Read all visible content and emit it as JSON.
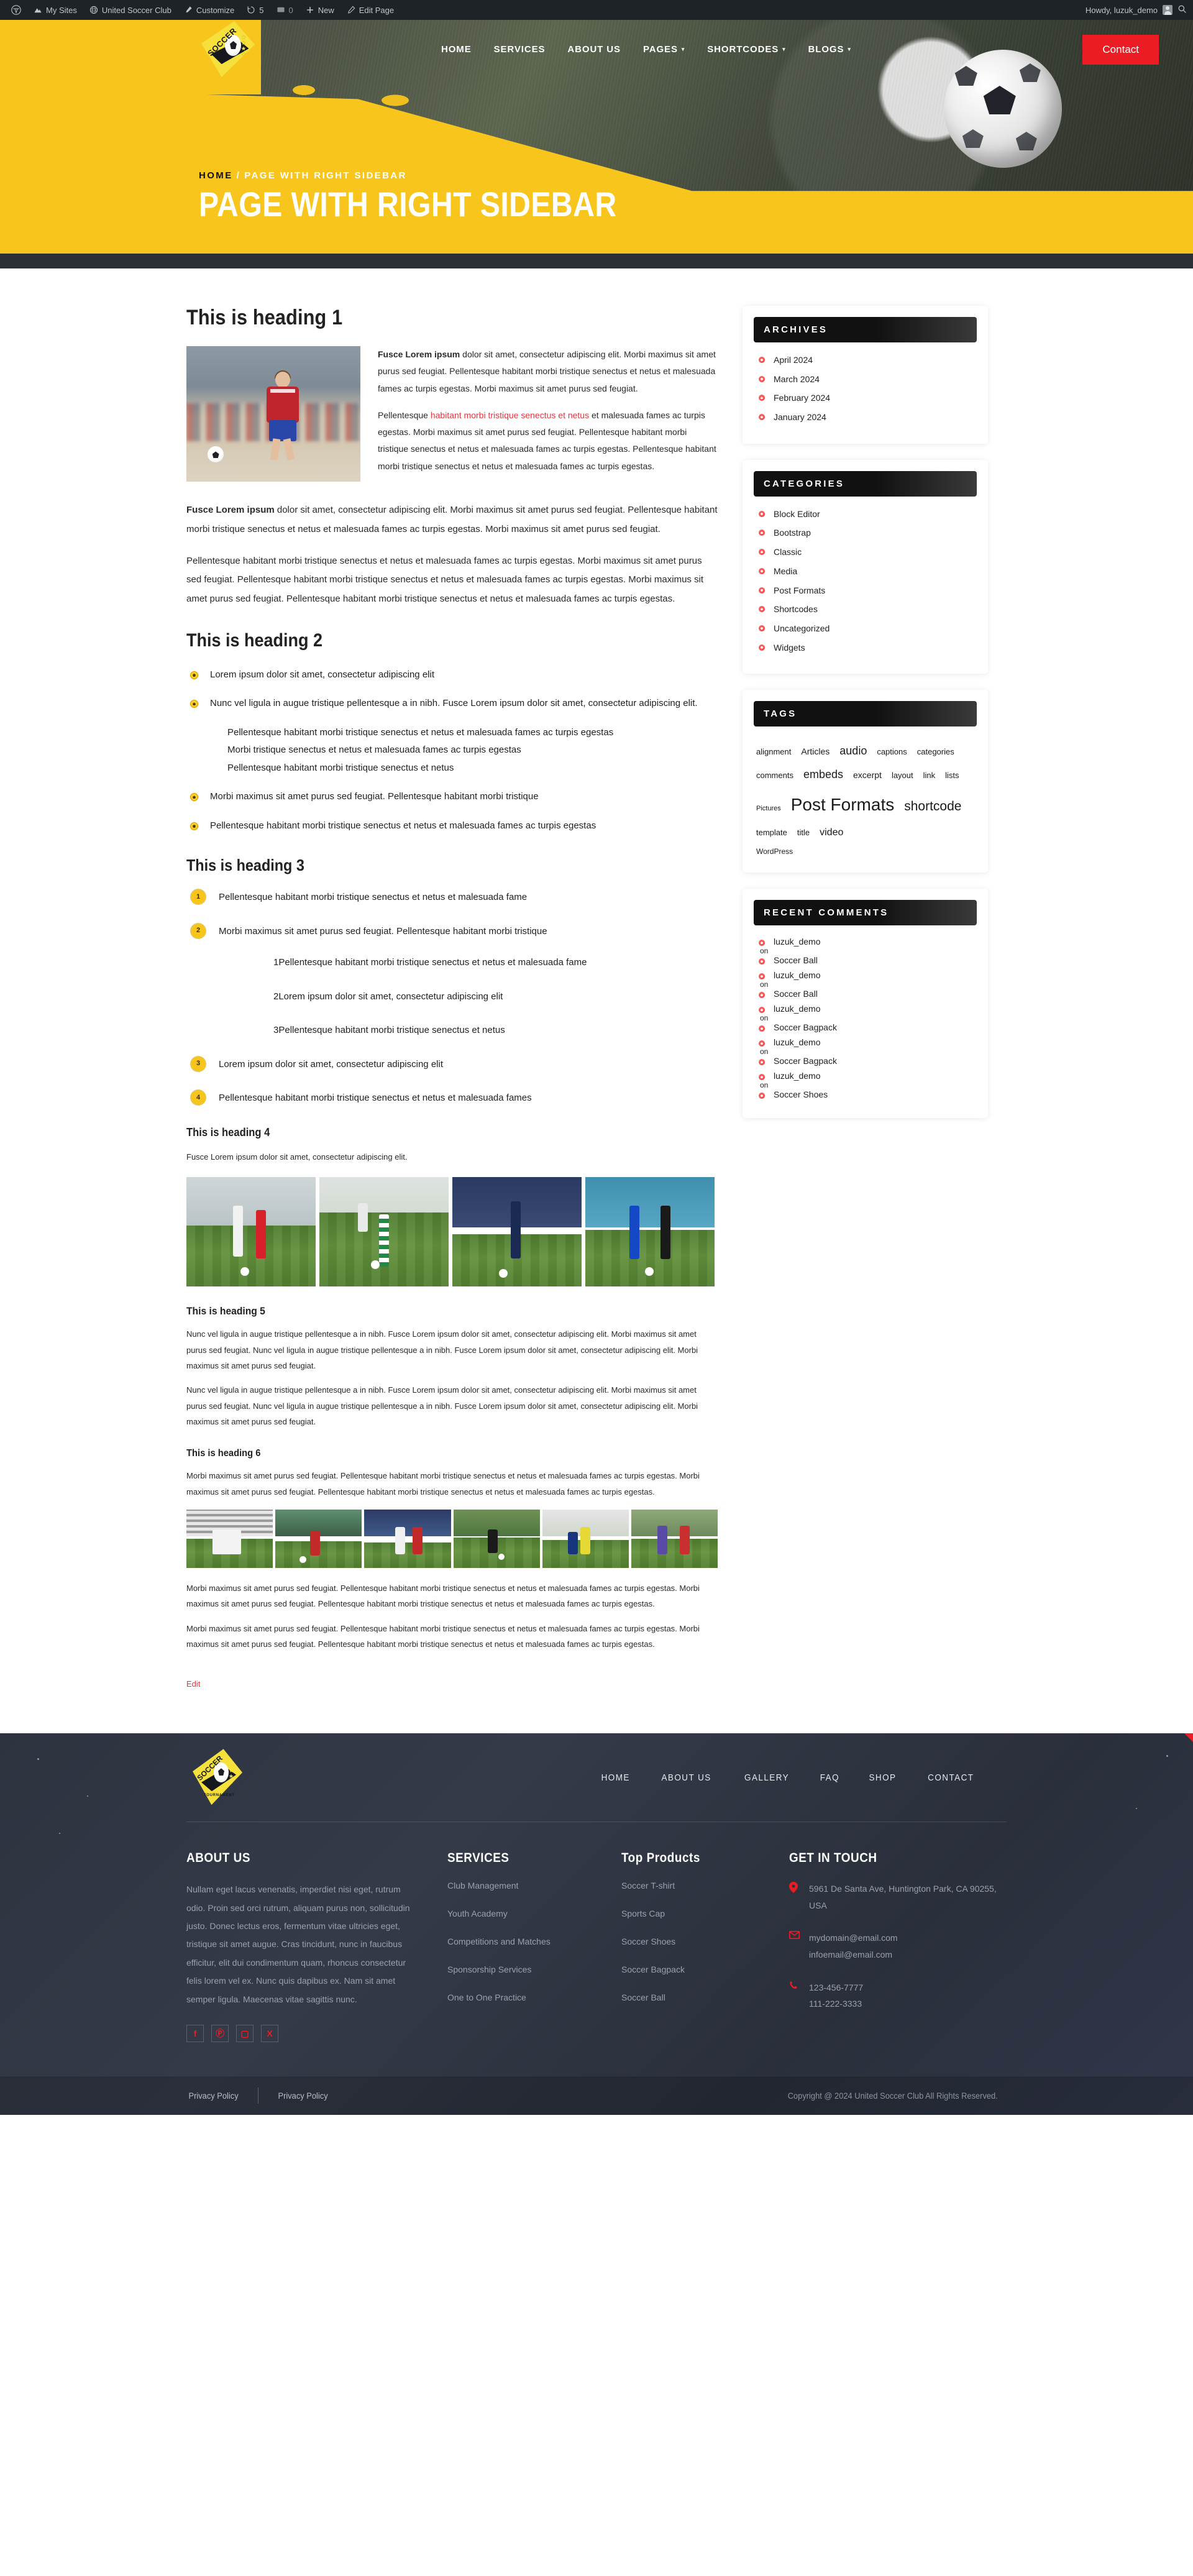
{
  "adminbar": {
    "items": [
      {
        "icon": "wordpress-icon",
        "label": ""
      },
      {
        "icon": "my-sites-icon",
        "label": "My Sites"
      },
      {
        "icon": "site-icon",
        "label": "United Soccer Club"
      },
      {
        "icon": "customize-icon",
        "label": "Customize"
      },
      {
        "icon": "updates-icon",
        "label": "5"
      },
      {
        "icon": "comments-icon",
        "label": "0"
      },
      {
        "icon": "new-icon",
        "label": "New"
      },
      {
        "icon": "edit-icon",
        "label": "Edit Page"
      }
    ],
    "howdy": "Howdy, luzuk_demo",
    "search_icon": "search-icon"
  },
  "header": {
    "logo_text": "SOCCER",
    "nav": [
      {
        "label": "HOME",
        "has_caret": false
      },
      {
        "label": "SERVICES",
        "has_caret": false
      },
      {
        "label": "ABOUT US",
        "has_caret": false
      },
      {
        "label": "PAGES",
        "has_caret": true
      },
      {
        "label": "SHORTCODES",
        "has_caret": true
      },
      {
        "label": "BLOGS",
        "has_caret": true
      }
    ],
    "contact_button": "Contact",
    "breadcrumb_home": "HOME",
    "breadcrumb_sep": "/",
    "breadcrumb_current": "PAGE WITH RIGHT SIDEBAR",
    "page_title": "PAGE WITH RIGHT SIDEBAR"
  },
  "colors": {
    "accent_yellow": "#f7c51b",
    "accent_red": "#ec1c24",
    "link_red": "#e8333a",
    "dark": "#2b2f36",
    "footer_bg": "#2e3340"
  },
  "content": {
    "h1": "This is heading 1",
    "intro_p1_bold": "Fusce Lorem ipsum",
    "intro_p1_rest": " dolor sit amet, consectetur adipiscing elit. Morbi maximus sit amet purus sed feugiat. Pellentesque habitant morbi tristique senectus et netus et malesuada fames ac turpis egestas. Morbi maximus sit amet purus sed feugiat.",
    "intro_p2_a": "Pellentesque ",
    "intro_p2_link": "habitant morbi tristique senectus et netus",
    "intro_p2_b": " et malesuada fames ac turpis egestas. Morbi maximus sit amet purus sed feugiat. Pellentesque habitant morbi tristique senectus et netus et malesuada fames ac turpis egestas. Pellentesque habitant morbi tristique senectus et netus et malesuada fames ac turpis egestas.",
    "p_after_bold": "Fusce Lorem ipsum",
    "p_after_rest": " dolor sit amet, consectetur adipiscing elit. Morbi maximus sit amet purus sed feugiat. Pellentesque habitant morbi tristique senectus et netus et malesuada fames ac turpis egestas. Morbi maximus sit amet purus sed feugiat.",
    "p_long": "Pellentesque habitant morbi tristique senectus et netus et malesuada fames ac turpis egestas. Morbi maximus sit amet purus sed feugiat. Pellentesque habitant morbi tristique senectus et netus et malesuada fames ac turpis egestas. Morbi maximus sit amet purus sed feugiat. Pellentesque habitant morbi tristique senectus et netus et malesuada fames ac turpis egestas.",
    "h2": "This is heading 2",
    "ul_items": [
      "Lorem ipsum dolor sit amet, consectetur adipiscing elit",
      "Nunc vel ligula in augue tristique pellentesque a in nibh. Fusce Lorem ipsum dolor sit amet, consectetur adipiscing elit."
    ],
    "ul_sub_items": [
      "Pellentesque habitant morbi tristique senectus et netus et malesuada fames ac turpis egestas",
      "Morbi tristique senectus et netus et malesuada fames ac turpis egestas",
      "Pellentesque habitant morbi tristique senectus et netus"
    ],
    "ul_items_after": [
      "Morbi maximus sit amet purus sed feugiat. Pellentesque habitant morbi tristique",
      "Pellentesque habitant morbi tristique senectus et netus et malesuada fames ac turpis egestas"
    ],
    "h3": "This is heading 3",
    "ol_items": [
      "Pellentesque habitant morbi tristique senectus et netus et malesuada fame",
      "Morbi maximus sit amet purus sed feugiat. Pellentesque habitant morbi tristique"
    ],
    "ol_sub_items": [
      "Pellentesque habitant morbi tristique senectus et netus et malesuada fame",
      "Lorem ipsum dolor sit amet, consectetur adipiscing elit",
      "Pellentesque habitant morbi tristique senectus et netus"
    ],
    "ol_items_after": [
      "Lorem ipsum dolor sit amet, consectetur adipiscing elit",
      "Pellentesque habitant morbi tristique senectus et netus et malesuada fames"
    ],
    "h4": "This is heading 4",
    "h4_p": "Fusce Lorem ipsum dolor sit amet, consectetur adipiscing elit.",
    "h5": "This is heading 5",
    "h5_p1": "Nunc vel ligula in augue tristique pellentesque a in nibh. Fusce Lorem ipsum dolor sit amet, consectetur adipiscing elit. Morbi maximus sit amet purus sed feugiat. Nunc vel ligula in augue tristique pellentesque a in nibh. Fusce Lorem ipsum dolor sit amet, consectetur adipiscing elit. Morbi maximus sit amet purus sed feugiat.",
    "h5_p2": "Nunc vel ligula in augue tristique pellentesque a in nibh. Fusce Lorem ipsum dolor sit amet, consectetur adipiscing elit. Morbi maximus sit amet purus sed feugiat. Nunc vel ligula in augue tristique pellentesque a in nibh. Fusce Lorem ipsum dolor sit amet, consectetur adipiscing elit. Morbi maximus sit amet purus sed feugiat.",
    "h6": "This is heading 6",
    "h6_p": "Morbi maximus sit amet purus sed feugiat. Pellentesque habitant morbi tristique senectus et netus et malesuada fames ac turpis egestas. Morbi maximus sit amet purus sed feugiat. Pellentesque habitant morbi tristique senectus et netus et malesuada fames ac turpis egestas.",
    "h6_p2": "Morbi maximus sit amet purus sed feugiat. Pellentesque habitant morbi tristique senectus et netus et malesuada fames ac turpis egestas. Morbi maximus sit amet purus sed feugiat. Pellentesque habitant morbi tristique senectus et netus et malesuada fames ac turpis egestas.",
    "h6_p3": "Morbi maximus sit amet purus sed feugiat. Pellentesque habitant morbi tristique senectus et netus et malesuada fames ac turpis egestas. Morbi maximus sit amet purus sed feugiat. Pellentesque habitant morbi tristique senectus et netus et malesuada fames ac turpis egestas.",
    "edit_link": "Edit"
  },
  "sidebar": {
    "archives": {
      "title": "ARCHIVES",
      "items": [
        "April 2024",
        "March 2024",
        "February 2024",
        "January 2024"
      ]
    },
    "categories": {
      "title": "CATEGORIES",
      "items": [
        "Block Editor",
        "Bootstrap",
        "Classic",
        "Media",
        "Post Formats",
        "Shortcodes",
        "Uncategorized",
        "Widgets"
      ]
    },
    "tags": {
      "title": "TAGS",
      "items": [
        {
          "label": "alignment",
          "size": 13
        },
        {
          "label": "Articles",
          "size": 14
        },
        {
          "label": "audio",
          "size": 18
        },
        {
          "label": "captions",
          "size": 13
        },
        {
          "label": "categories",
          "size": 13
        },
        {
          "label": "comments",
          "size": 13
        },
        {
          "label": "embeds",
          "size": 18
        },
        {
          "label": "excerpt",
          "size": 14
        },
        {
          "label": "layout",
          "size": 13
        },
        {
          "label": "link",
          "size": 13
        },
        {
          "label": "lists",
          "size": 13
        },
        {
          "label": "Pictures",
          "size": 11
        },
        {
          "label": "Post Formats",
          "size": 28
        },
        {
          "label": "shortcode",
          "size": 21
        },
        {
          "label": "template",
          "size": 13
        },
        {
          "label": "title",
          "size": 13
        },
        {
          "label": "video",
          "size": 16
        },
        {
          "label": "WordPress",
          "size": 12
        }
      ]
    },
    "recent_comments": {
      "title": "RECENT COMMENTS",
      "on_label": "on",
      "items": [
        {
          "author": "luzuk_demo",
          "post": "Soccer Ball"
        },
        {
          "author": "luzuk_demo",
          "post": "Soccer Ball"
        },
        {
          "author": "luzuk_demo",
          "post": "Soccer Bagpack"
        },
        {
          "author": "luzuk_demo",
          "post": "Soccer Bagpack"
        },
        {
          "author": "luzuk_demo",
          "post": "Soccer Shoes"
        }
      ]
    }
  },
  "footer": {
    "logo_text": "SOCCER",
    "logo_sub": "TOURNAMENT",
    "nav": [
      "HOME",
      "ABOUT US",
      "GALLERY",
      "FAQ",
      "SHOP",
      "CONTACT"
    ],
    "about": {
      "title": "ABOUT US",
      "text": "Nullam eget lacus venenatis, imperdiet nisi eget, rutrum odio. Proin sed orci rutrum, aliquam purus non, sollicitudin justo. Donec lectus eros, fermentum vitae ultricies eget, tristique sit amet augue. Cras tincidunt, nunc in faucibus efficitur, elit dui condimentum quam, rhoncus consectetur felis lorem vel ex. Nunc quis dapibus ex. Nam sit amet semper ligula. Maecenas vitae sagittis nunc.",
      "social": [
        {
          "icon": "facebook-icon",
          "glyph": "f"
        },
        {
          "icon": "pinterest-icon",
          "glyph": "Ⓟ"
        },
        {
          "icon": "instagram-icon",
          "glyph": "▢"
        },
        {
          "icon": "x-twitter-icon",
          "glyph": "X"
        }
      ]
    },
    "services": {
      "title": "SERVICES",
      "items": [
        "Club Management",
        "Youth Academy",
        "Competitions and Matches",
        "Sponsorship Services",
        "One to One Practice"
      ]
    },
    "products": {
      "title": "Top Products",
      "items": [
        "Soccer T-shirt",
        "Sports Cap",
        "Soccer Shoes",
        "Soccer Bagpack",
        "Soccer Ball"
      ]
    },
    "contact": {
      "title": "GET IN TOUCH",
      "address": "5961 De Santa Ave, Huntington Park, CA 90255, USA",
      "emails": [
        "mydomain@email.com",
        "infoemail@email.com"
      ],
      "phones": [
        "123-456-7777",
        "111-222-3333"
      ]
    },
    "bottom": {
      "links": [
        "Privacy Policy",
        "Privacy Policy"
      ],
      "copyright": "Copyright @ 2024 United Soccer Club All Rights Reserved."
    }
  }
}
